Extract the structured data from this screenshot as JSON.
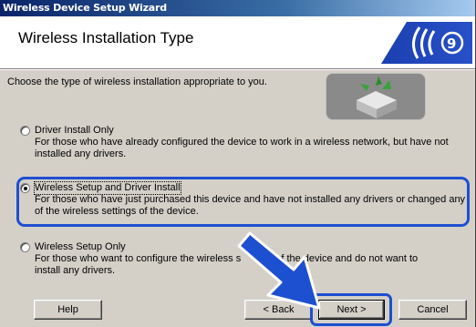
{
  "window": {
    "title": "Wireless Device Setup Wizard"
  },
  "header": {
    "title": "Wireless Installation Type"
  },
  "instruction": "Choose the type of wireless installation appropriate to you.",
  "options": [
    {
      "label": "Driver Install Only",
      "description": "For those who have already configured the device to work in a wireless network, but have not installed any drivers.",
      "selected": false
    },
    {
      "label": "Wireless Setup and Driver Install",
      "description": "For those who have just purchased this device and have not installed any drivers or changed any of the wireless settings of the device.",
      "selected": true
    },
    {
      "label": "Wireless Setup Only",
      "description_part1": "For those who want to configure the wireless s",
      "description_part2": "of the device and do not want to",
      "description_line2": "install any drivers.",
      "selected": false
    }
  ],
  "buttons": {
    "help": "Help",
    "back": "< Back",
    "next": "Next >",
    "cancel": "Cancel"
  },
  "colors": {
    "title_bar": "#0a246a",
    "highlight": "#1d4fd1",
    "dialog": "#d4d0c8"
  },
  "icons": {
    "logo": "wireless-signal-icon",
    "box": "package-icon",
    "arrow": "pointer-arrow-icon"
  }
}
